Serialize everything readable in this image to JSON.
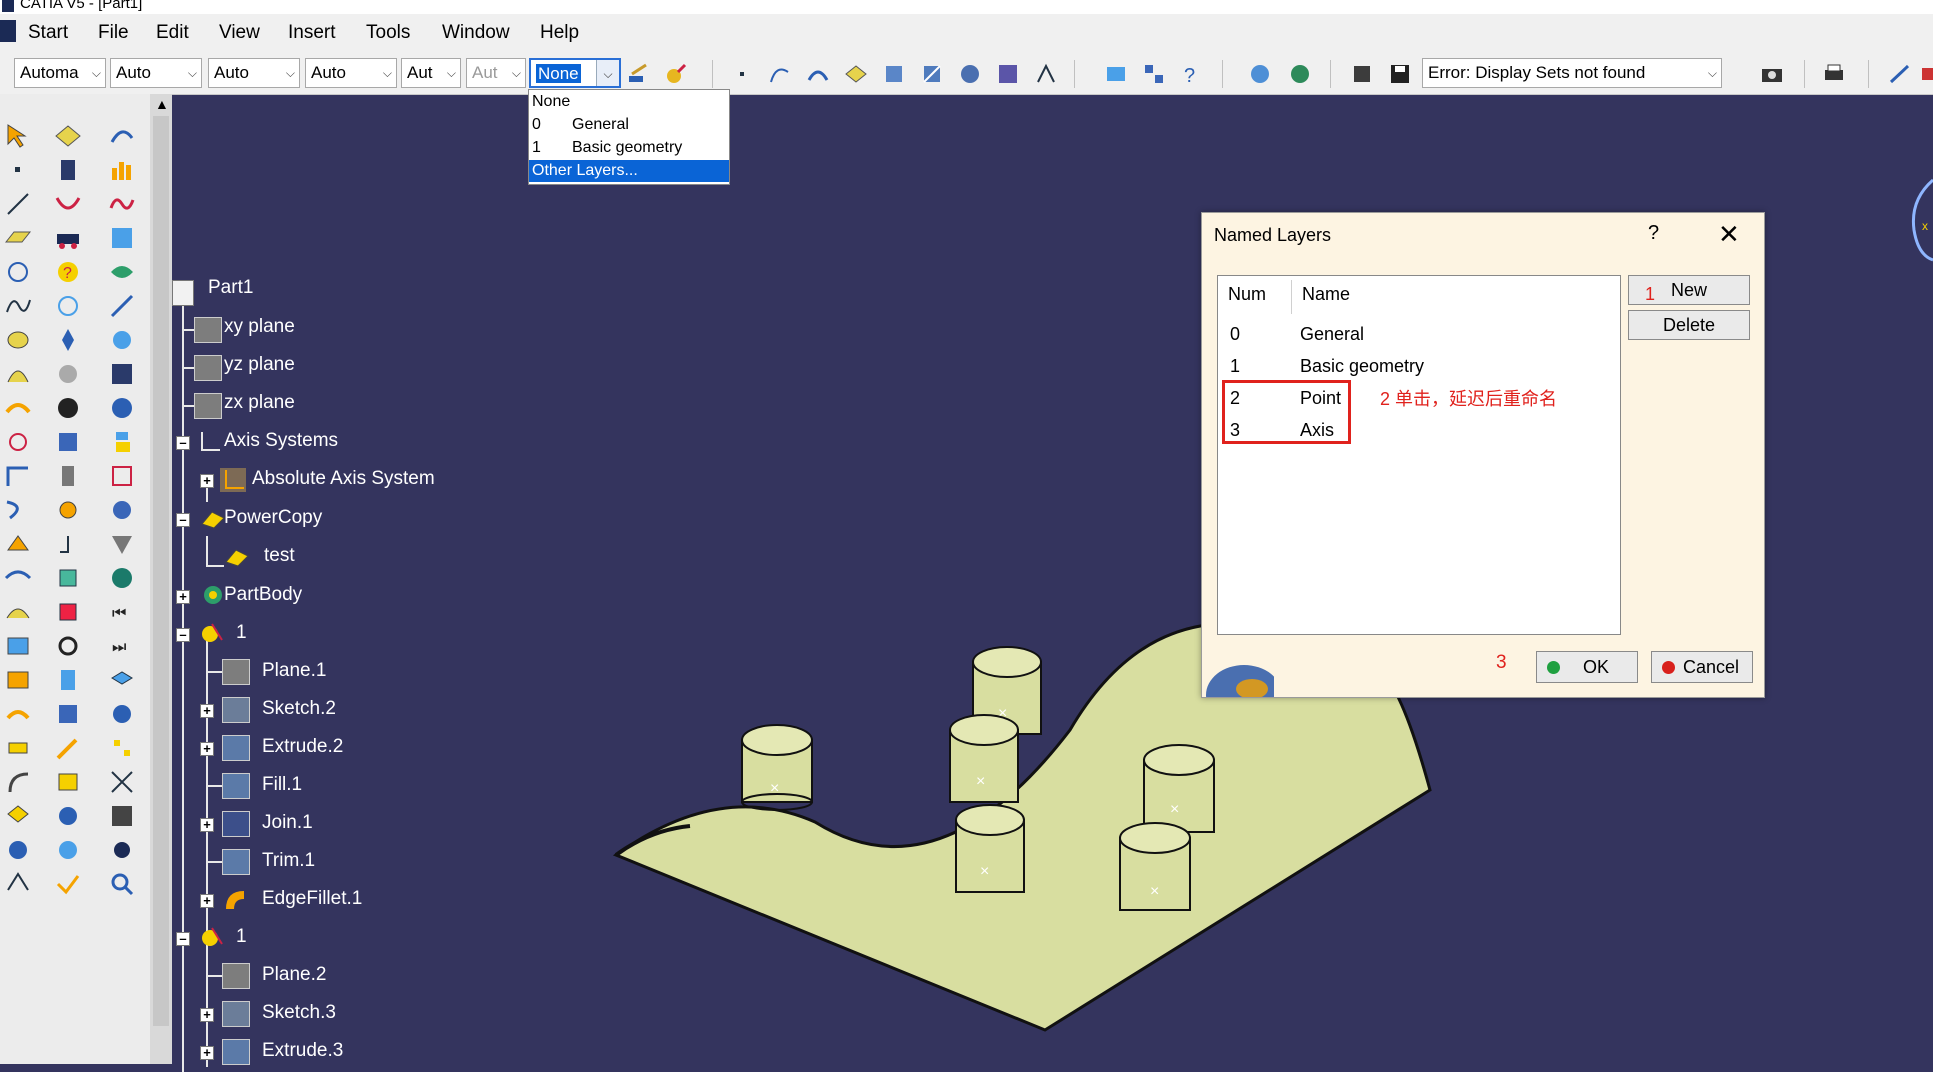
{
  "window": {
    "title": "CATIA V5 - [Part1]"
  },
  "menu": {
    "items": [
      "Start",
      "File",
      "Edit",
      "View",
      "Insert",
      "Tools",
      "Window",
      "Help"
    ]
  },
  "toolbar": {
    "combos": [
      "Automa",
      "Auto",
      "Auto",
      "Auto",
      "Aut",
      "Aut"
    ],
    "layer_value": "None",
    "display_sets_value": "Error: Display Sets not found"
  },
  "layer_dropdown": {
    "items": [
      {
        "num": "",
        "name": "None"
      },
      {
        "num": "0",
        "name": "General"
      },
      {
        "num": "1",
        "name": "Basic geometry"
      },
      {
        "num": "",
        "name": "Other Layers..."
      }
    ]
  },
  "tree": {
    "nodes": [
      {
        "label": "Part1",
        "icon": "part-icon"
      },
      {
        "label": "xy plane",
        "icon": "plane-icon"
      },
      {
        "label": "yz plane",
        "icon": "plane-icon"
      },
      {
        "label": "zx plane",
        "icon": "plane-icon"
      },
      {
        "label": "Axis Systems",
        "icon": "axis-icon"
      },
      {
        "label": "Absolute Axis System",
        "icon": "axis-icon"
      },
      {
        "label": "PowerCopy",
        "icon": "powercopy-icon"
      },
      {
        "label": "test",
        "icon": "powercopy-icon"
      },
      {
        "label": "PartBody",
        "icon": "gear-icon"
      },
      {
        "label": "1",
        "icon": "geoset-icon"
      },
      {
        "label": "Plane.1",
        "icon": "plane-icon"
      },
      {
        "label": "Sketch.2",
        "icon": "sketch-icon"
      },
      {
        "label": "Extrude.2",
        "icon": "extrude-icon"
      },
      {
        "label": "Fill.1",
        "icon": "fill-icon"
      },
      {
        "label": "Join.1",
        "icon": "join-icon"
      },
      {
        "label": "Trim.1",
        "icon": "trim-icon"
      },
      {
        "label": "EdgeFillet.1",
        "icon": "fillet-icon"
      },
      {
        "label": "1",
        "icon": "geoset-icon"
      },
      {
        "label": "Plane.2",
        "icon": "plane-icon"
      },
      {
        "label": "Sketch.3",
        "icon": "sketch-icon"
      },
      {
        "label": "Extrude.3",
        "icon": "extrude-icon"
      }
    ]
  },
  "dialog": {
    "title": "Named Layers",
    "help": "?",
    "close": "✕",
    "col_num": "Num",
    "col_name": "Name",
    "rows": [
      {
        "num": "0",
        "name": "General"
      },
      {
        "num": "1",
        "name": "Basic geometry"
      },
      {
        "num": "2",
        "name": "Point"
      },
      {
        "num": "3",
        "name": "Axis"
      }
    ],
    "new_label": "New",
    "delete_label": "Delete",
    "ok_label": "OK",
    "cancel_label": "Cancel",
    "annotations": {
      "a1": "1",
      "a2": "2 单击，延迟后重命名",
      "a3": "3"
    }
  },
  "colors": {
    "viewport": "#34345e",
    "surface": "#d8dea0",
    "annotation": "#e0221d",
    "dialog_bg": "#fdf4e2"
  }
}
